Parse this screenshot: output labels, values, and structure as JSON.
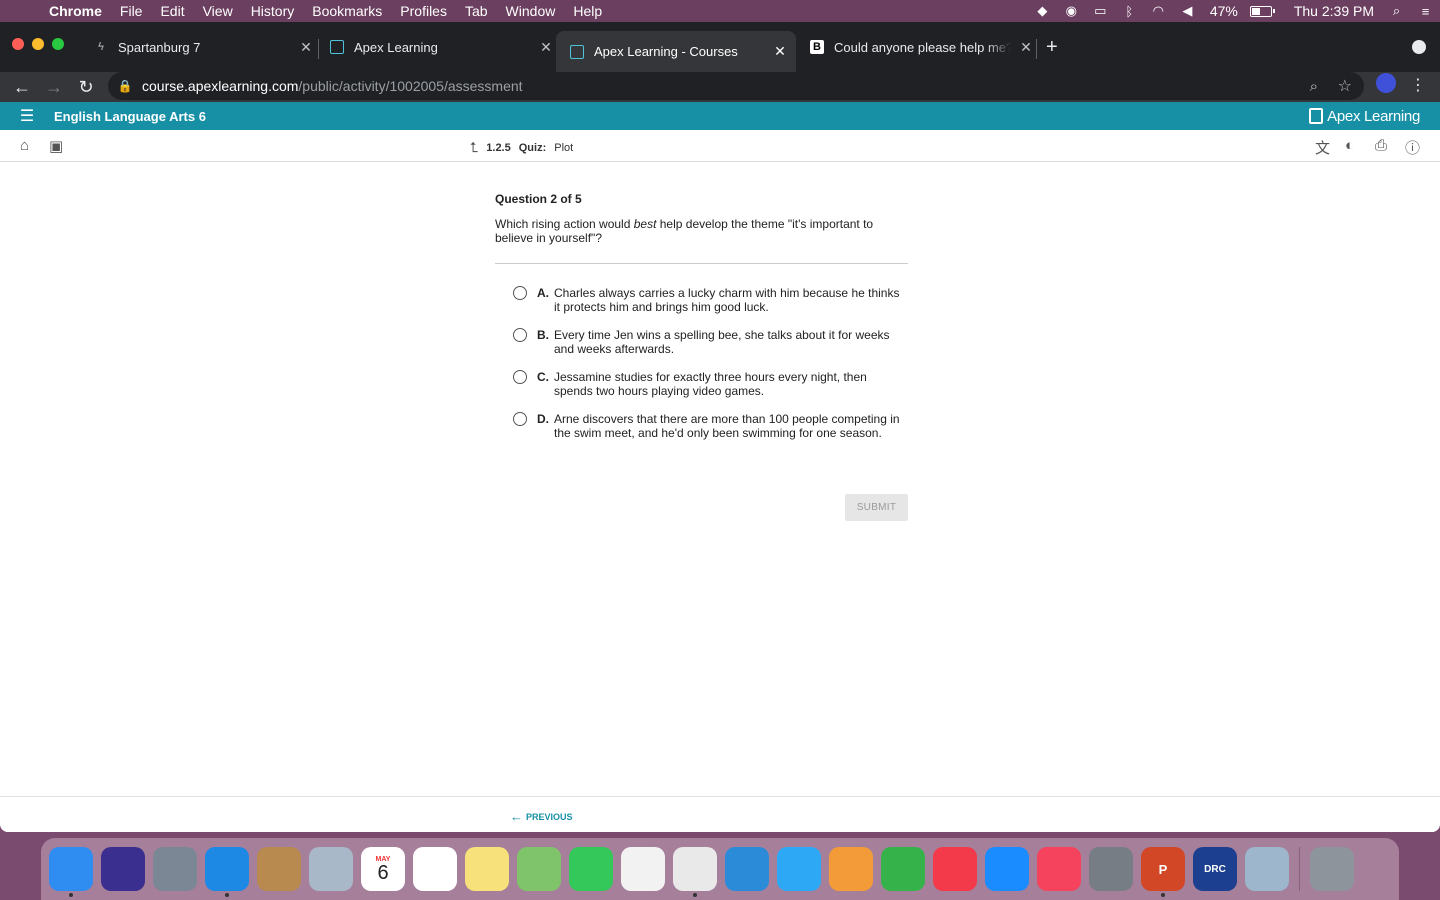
{
  "menubar": {
    "app": "Chrome",
    "items": [
      "File",
      "Edit",
      "View",
      "History",
      "Bookmarks",
      "Profiles",
      "Tab",
      "Window",
      "Help"
    ],
    "battery": "47%",
    "battery_level": 0.47,
    "clock": "Thu 2:39 PM"
  },
  "tabs": [
    {
      "title": "Spartanburg 7",
      "favicon": "bolt-icon"
    },
    {
      "title": "Apex Learning",
      "favicon": "apex-icon"
    },
    {
      "title": "Apex Learning - Courses",
      "favicon": "apex-icon"
    },
    {
      "title": "Could anyone please help me?",
      "favicon": "brainly-icon"
    }
  ],
  "address": {
    "host": "course.apexlearning.com",
    "path": "/public/activity/1002005/assessment"
  },
  "app": {
    "course_title": "English Language Arts 6",
    "brand": "Apex Learning",
    "breadcrumb_number": "1.2.5",
    "breadcrumb_type": "Quiz:",
    "breadcrumb_name": "Plot"
  },
  "question": {
    "counter": "Question 2 of 5",
    "text_before": "Which rising action would ",
    "text_emph": "best",
    "text_after": " help develop the theme \"it's important to believe in yourself\"?",
    "answers": [
      {
        "letter": "A.",
        "text": "Charles always carries a lucky charm with him because he thinks it protects him and brings him good luck."
      },
      {
        "letter": "B.",
        "text": "Every time Jen wins a spelling bee, she talks about it for weeks and weeks afterwards."
      },
      {
        "letter": "C.",
        "text": "Jessamine studies for exactly three hours every night, then spends two hours playing video games."
      },
      {
        "letter": "D.",
        "text": "Arne discovers that there are more than 100 people competing in the swim meet, and he'd only been swimming for one season."
      }
    ],
    "submit_label": "SUBMIT"
  },
  "footer": {
    "previous_label": "PREVIOUS"
  },
  "dock": {
    "calendar_month": "MAY",
    "calendar_day": "6",
    "apps": [
      {
        "name": "finder-icon",
        "color": "#2f8cf0"
      },
      {
        "name": "siri-icon",
        "color": "#3a2f8f"
      },
      {
        "name": "launchpad-icon",
        "color": "#7c8796"
      },
      {
        "name": "safari-icon",
        "color": "#1e88e5"
      },
      {
        "name": "contacts-icon",
        "color": "#b98a50"
      },
      {
        "name": "mail-icon",
        "color": "#a9b8c8"
      },
      {
        "name": "calendar-icon",
        "color": "#ffffff"
      },
      {
        "name": "reminders-icon",
        "color": "#ffffff"
      },
      {
        "name": "notes-icon",
        "color": "#f7e17a"
      },
      {
        "name": "maps-icon",
        "color": "#7fc46b"
      },
      {
        "name": "facetime-icon",
        "color": "#34c759"
      },
      {
        "name": "photos-icon",
        "color": "#f2f2f2"
      },
      {
        "name": "chrome-icon",
        "color": "#e9e9e9"
      },
      {
        "name": "keynote-icon",
        "color": "#2c8bd8"
      },
      {
        "name": "messages-icon",
        "color": "#2da8f5"
      },
      {
        "name": "pages-icon",
        "color": "#f29b38"
      },
      {
        "name": "numbers-icon",
        "color": "#35b24a"
      },
      {
        "name": "news-icon",
        "color": "#f23a4b"
      },
      {
        "name": "appstore-icon",
        "color": "#1a8cff"
      },
      {
        "name": "music-icon",
        "color": "#f5425d"
      },
      {
        "name": "system-preferences-icon",
        "color": "#777d84"
      },
      {
        "name": "powerpoint-icon",
        "color": "#d24726"
      },
      {
        "name": "drc-insight-icon",
        "color": "#1d3f8f"
      },
      {
        "name": "preview-icon",
        "color": "#9eb6cc"
      },
      {
        "name": "trash-icon",
        "color": "#8d949b"
      }
    ]
  },
  "colors": {
    "accent": "#1790a6",
    "submit_disabled_bg": "#e6e6e6"
  }
}
